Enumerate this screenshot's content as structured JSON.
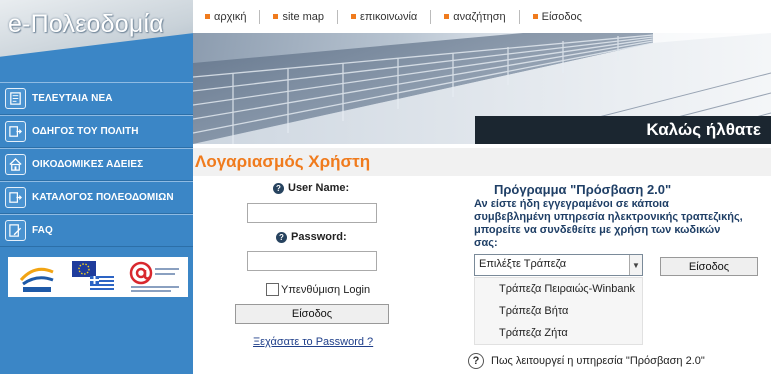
{
  "logo": {
    "title": "e-Πολεοδομία"
  },
  "sidebar": {
    "items": [
      {
        "label": "ΤΕΛΕΥΤΑΙΑ ΝΕΑ",
        "icon": "news-icon"
      },
      {
        "label": "ΟΔΗΓΟΣ ΤΟΥ ΠΟΛΙΤΗ",
        "icon": "guide-icon"
      },
      {
        "label": "ΟΙΚΟΔΟΜΙΚΕΣ ΑΔΕΙΕΣ",
        "icon": "house-icon"
      },
      {
        "label": "ΚΑΤΑΛΟΓΟΣ ΠΟΛΕΟΔΟΜΙΩΝ",
        "icon": "catalog-icon"
      },
      {
        "label": "FAQ",
        "icon": "faq-icon"
      }
    ]
  },
  "topnav": {
    "items": [
      "αρχική",
      "site map",
      "επικοινωνία",
      "αναζήτηση",
      "Είσοδος"
    ],
    "bullet_color": "#f07b1d"
  },
  "banner": {
    "welcome": "Καλώς ήλθατε"
  },
  "account": {
    "header": "Λογαριασμός Χρήστη",
    "username_label": "User Name:",
    "username_value": "",
    "password_label": "Password:",
    "password_value": "",
    "remember_label": "Υπενθύμιση Login",
    "remember_checked": false,
    "login_button": "Είσοδος",
    "forgot_link": "Ξεχάσατε το Password ?"
  },
  "prosvasi": {
    "title": "Πρόγραμμα \"Πρόσβαση 2.0\"",
    "description": "Αν είστε ήδη εγγεγραμένοι σε κάποια συμβεβλημένη υπηρεσία ηλεκτρονικής τραπεζικής, μπορείτε να συνδεθείτε με χρήση των κωδικών σας:",
    "select_value": "Επιλέξτε Τράπεζα",
    "options": [
      "Τράπεζα Πειραιώς-Winbank",
      "Τράπεζα Βήτα",
      "Τράπεζα Ζήτα"
    ],
    "login_button": "Είσοδος",
    "help_text": "Πως λειτουργεί η υπηρεσία \"Πρόσβαση 2.0\""
  },
  "colors": {
    "sidebar": "#3b86c6",
    "accent": "#f07b1d",
    "title_blue": "#1f3f66"
  }
}
